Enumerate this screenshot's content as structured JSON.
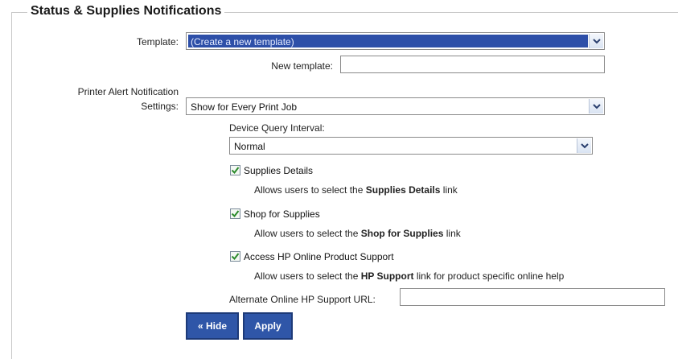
{
  "section": {
    "title": "Status & Supplies Notifications"
  },
  "template": {
    "label": "Template:",
    "selected": "(Create a new template)",
    "new_template_label": "New template:",
    "new_template_value": ""
  },
  "printer_alert": {
    "label_line1": "Printer Alert Notification",
    "label_line2": "Settings:",
    "selected": "Show for Every Print Job"
  },
  "device_query": {
    "label": "Device Query Interval:",
    "selected": "Normal"
  },
  "options": [
    {
      "label": "Supplies Details",
      "checked": true,
      "desc_prefix": "Allows users to select the ",
      "desc_bold": "Supplies Details",
      "desc_suffix": " link"
    },
    {
      "label": "Shop for Supplies",
      "checked": true,
      "desc_prefix": "Allow users to select the ",
      "desc_bold": "Shop for Supplies",
      "desc_suffix": " link"
    },
    {
      "label": "Access HP Online Product Support",
      "checked": true,
      "desc_prefix": "Allow users to select the ",
      "desc_bold": "HP Support",
      "desc_suffix": " link for product specific online help"
    }
  ],
  "alternate_url": {
    "label": "Alternate Online HP Support URL:",
    "value": ""
  },
  "buttons": {
    "hide": "« Hide",
    "apply": "Apply"
  },
  "colors": {
    "button_bg": "#2f56a8",
    "selected_bg": "#2d4fa8",
    "check": "#2a8a2a"
  }
}
